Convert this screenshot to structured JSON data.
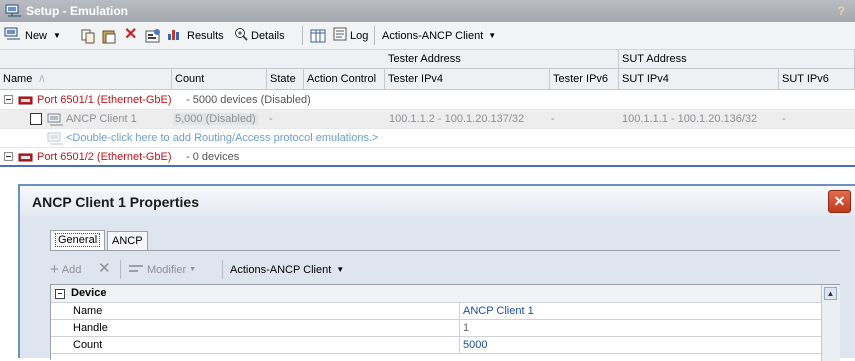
{
  "window": {
    "title": "Setup - Emulation",
    "help": "?"
  },
  "toolbar": {
    "new_label": "New",
    "results_label": "Results",
    "details_label": "Details",
    "log_label": "Log",
    "actions_label": "Actions-ANCP Client"
  },
  "grid": {
    "group_headers": {
      "tester_address": "Tester Address",
      "sut_address": "SUT Address"
    },
    "columns": {
      "name": "Name",
      "count": "Count",
      "state": "State",
      "action_control": "Action Control",
      "tester_ipv4": "Tester IPv4",
      "tester_ipv6": "Tester IPv6",
      "sut_ipv4": "SUT IPv4",
      "sut_ipv6": "SUT IPv6"
    },
    "rows": [
      {
        "type": "port",
        "name": "Port 6501/1 (Ethernet-GbE)",
        "suffix": " - 5000 devices (Disabled)"
      },
      {
        "type": "device",
        "name": "ANCP Client 1",
        "count": "5,000 (Disabled)",
        "state": "-",
        "tester_ipv4": "100.1.1.2 - 100.1.20.137/32",
        "tester_ipv6": "-",
        "sut_ipv4": "100.1.1.1 - 100.1.20.136/32",
        "sut_ipv6": "-"
      },
      {
        "type": "hint",
        "text": "<Double-click here to add Routing/Access protocol emulations.>"
      },
      {
        "type": "port",
        "name": "Port 6501/2 (Ethernet-GbE)",
        "suffix": " - 0 devices"
      }
    ]
  },
  "dialog": {
    "title": "ANCP Client 1 Properties",
    "close": "✕",
    "tabs": [
      "General",
      "ANCP"
    ],
    "toolbar": {
      "add_label": "Add",
      "modifier_label": "Modifier",
      "actions_label": "Actions-ANCP Client"
    },
    "section_label": "Device",
    "properties": [
      {
        "name": "Name",
        "value": "ANCP Client 1"
      },
      {
        "name": "Handle",
        "value": "1"
      },
      {
        "name": "Count",
        "value": "5000"
      }
    ]
  },
  "colors": {
    "port_text": "#c0141c",
    "dialog_border": "#6c8fc4",
    "close_button": "#c23a1c"
  }
}
